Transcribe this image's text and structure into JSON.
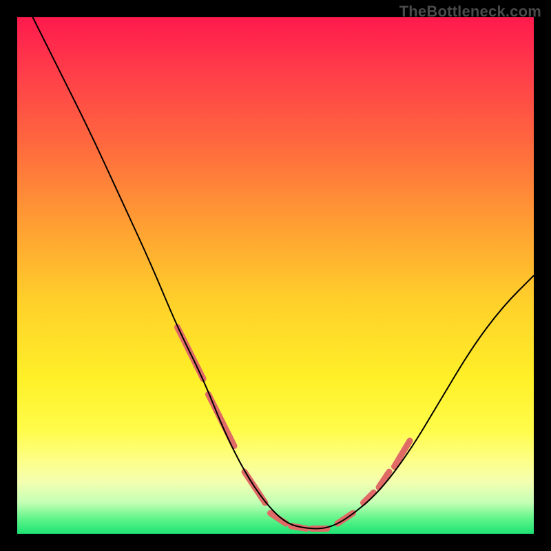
{
  "watermark": "TheBottleneck.com",
  "chart_data": {
    "type": "line",
    "title": "",
    "xlabel": "",
    "ylabel": "",
    "xlim": [
      0,
      100
    ],
    "ylim": [
      0,
      100
    ],
    "grid": false,
    "legend": false,
    "gradient_stops": [
      {
        "pct": 0,
        "color": "#ff1a4d"
      },
      {
        "pct": 10,
        "color": "#ff3b4a"
      },
      {
        "pct": 25,
        "color": "#ff6a3e"
      },
      {
        "pct": 40,
        "color": "#ff9e33"
      },
      {
        "pct": 55,
        "color": "#ffd02a"
      },
      {
        "pct": 70,
        "color": "#fff028"
      },
      {
        "pct": 80,
        "color": "#fffc4a"
      },
      {
        "pct": 86,
        "color": "#fdff8a"
      },
      {
        "pct": 90,
        "color": "#f3ffb0"
      },
      {
        "pct": 94,
        "color": "#c3ffb5"
      },
      {
        "pct": 97,
        "color": "#62f58a"
      },
      {
        "pct": 100,
        "color": "#1de373"
      }
    ],
    "series": [
      {
        "name": "bottleneck-curve",
        "x": [
          3,
          8,
          14,
          20,
          26,
          31,
          36,
          40,
          44,
          48,
          52,
          56,
          60,
          64,
          70,
          76,
          82,
          88,
          94,
          100
        ],
        "y": [
          100,
          90,
          78,
          65,
          52,
          40,
          30,
          20,
          12,
          6,
          2,
          1,
          1,
          3,
          8,
          16,
          26,
          36,
          44,
          50
        ]
      }
    ],
    "highlight_segments": [
      {
        "x0": 31,
        "y0": 40,
        "x1": 36,
        "y1": 30
      },
      {
        "x0": 37,
        "y0": 27,
        "x1": 42,
        "y1": 17
      },
      {
        "x0": 44,
        "y0": 12,
        "x1": 48,
        "y1": 6
      },
      {
        "x0": 49,
        "y0": 4,
        "x1": 52,
        "y1": 2
      },
      {
        "x0": 53,
        "y0": 1.5,
        "x1": 56,
        "y1": 1
      },
      {
        "x0": 57,
        "y0": 1,
        "x1": 60,
        "y1": 1
      },
      {
        "x0": 62,
        "y0": 2,
        "x1": 65,
        "y1": 4
      },
      {
        "x0": 67,
        "y0": 6,
        "x1": 69,
        "y1": 8
      },
      {
        "x0": 70,
        "y0": 9,
        "x1": 72,
        "y1": 12
      },
      {
        "x0": 73,
        "y0": 13,
        "x1": 76,
        "y1": 18
      }
    ]
  }
}
